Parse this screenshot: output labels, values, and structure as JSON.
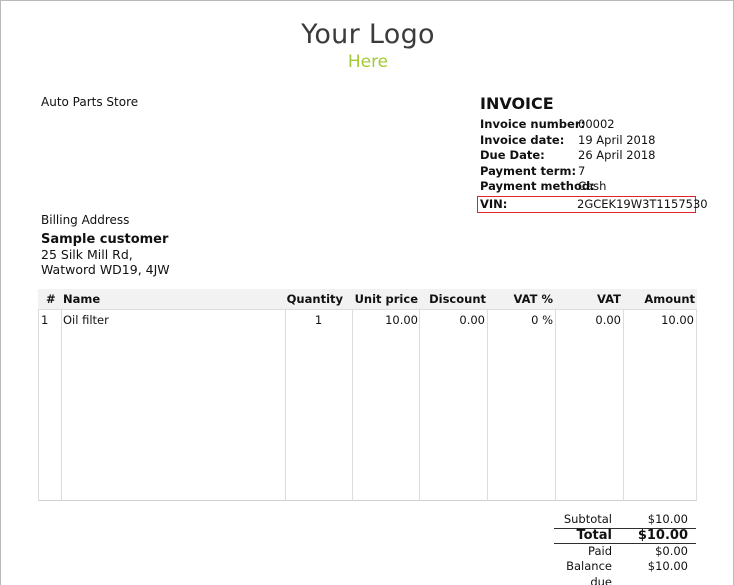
{
  "logo": {
    "main": "Your Logo",
    "sub": "Here"
  },
  "company": {
    "name": "Auto Parts Store"
  },
  "invoice": {
    "title": "INVOICE",
    "fields": [
      {
        "label": "Invoice number:",
        "value": "00002"
      },
      {
        "label": "Invoice date:",
        "value": "19 April 2018"
      },
      {
        "label": "Due Date:",
        "value": "26 April 2018"
      },
      {
        "label": "Payment term:",
        "value": "7"
      },
      {
        "label": "Payment method:",
        "value": "Cash"
      },
      {
        "label": "VIN:",
        "value": "2GCEK19W3T1157530"
      }
    ],
    "highlight_color": "#e0232b"
  },
  "billing": {
    "title": "Billing Address",
    "customer": "Sample customer",
    "address": [
      "25 Silk Mill Rd,",
      "Watword WD19, 4JW"
    ]
  },
  "items": {
    "headers": {
      "num": "#",
      "name": "Name",
      "quantity": "Quantity",
      "unit_price": "Unit price",
      "discount": "Discount",
      "vat_pct": "VAT %",
      "vat": "VAT",
      "amount": "Amount"
    },
    "rows": [
      {
        "num": "1",
        "name": "Oil filter",
        "quantity": "1",
        "unit_price": "10.00",
        "discount": "0.00",
        "vat_pct": "0 %",
        "vat": "0.00",
        "amount": "10.00"
      }
    ]
  },
  "totals": {
    "subtotal_label": "Subtotal",
    "subtotal_value": "$10.00",
    "total_label": "Total",
    "total_value": "$10.00",
    "paid_label": "Paid",
    "paid_value": "$0.00",
    "balance_label": "Balance due",
    "balance_value": "$10.00"
  }
}
